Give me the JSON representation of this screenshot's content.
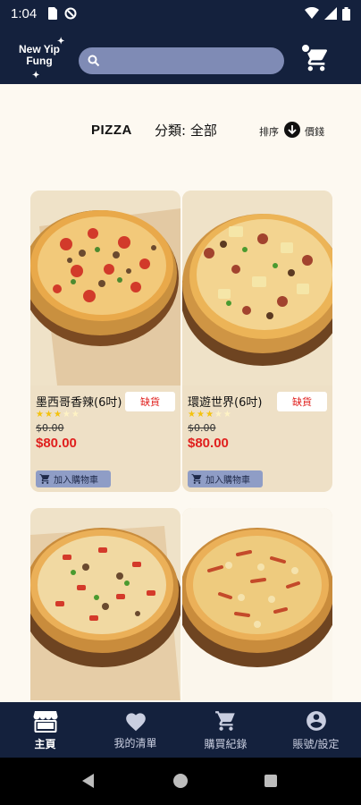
{
  "status_bar": {
    "time": "1:04"
  },
  "header": {
    "logo_line1": "New Yip",
    "logo_line2": "Fung",
    "search_placeholder": "",
    "search_value": ""
  },
  "filter": {
    "category_title": "PIZZA",
    "category_filter": "分類: 全部",
    "sort_label": "排序",
    "sort_value": "價錢"
  },
  "products": [
    {
      "name": "墨西哥香辣(6吋)",
      "badge": "缺貨",
      "rating": 3,
      "rating_max": 5,
      "original_price": "$0.00",
      "price": "$80.00",
      "add_to_cart_label": "加入購物車"
    },
    {
      "name": "環遊世界(6吋)",
      "badge": "缺貨",
      "rating": 3,
      "rating_max": 5,
      "original_price": "$0.00",
      "price": "$80.00",
      "add_to_cart_label": "加入購物車"
    },
    {
      "name": "",
      "badge": "",
      "original_price": "",
      "price": ""
    },
    {
      "name": "",
      "badge": "",
      "original_price": "",
      "price": ""
    }
  ],
  "bottom_nav": [
    {
      "label": "主頁",
      "icon": "storefront-icon",
      "active": true
    },
    {
      "label": "我的清單",
      "icon": "heart-icon",
      "active": false
    },
    {
      "label": "購買紀錄",
      "icon": "cart-icon",
      "active": false
    },
    {
      "label": "賬號/設定",
      "icon": "account-circle-icon",
      "active": false
    }
  ],
  "colors": {
    "header_bg": "#14213d",
    "page_bg": "#fdf9f1",
    "card_bg": "#eee0c6",
    "price_red": "#e0201e",
    "search_bg": "#7f8bb5",
    "star_filled": "#f4c20d",
    "star_empty": "#fff3c4"
  }
}
